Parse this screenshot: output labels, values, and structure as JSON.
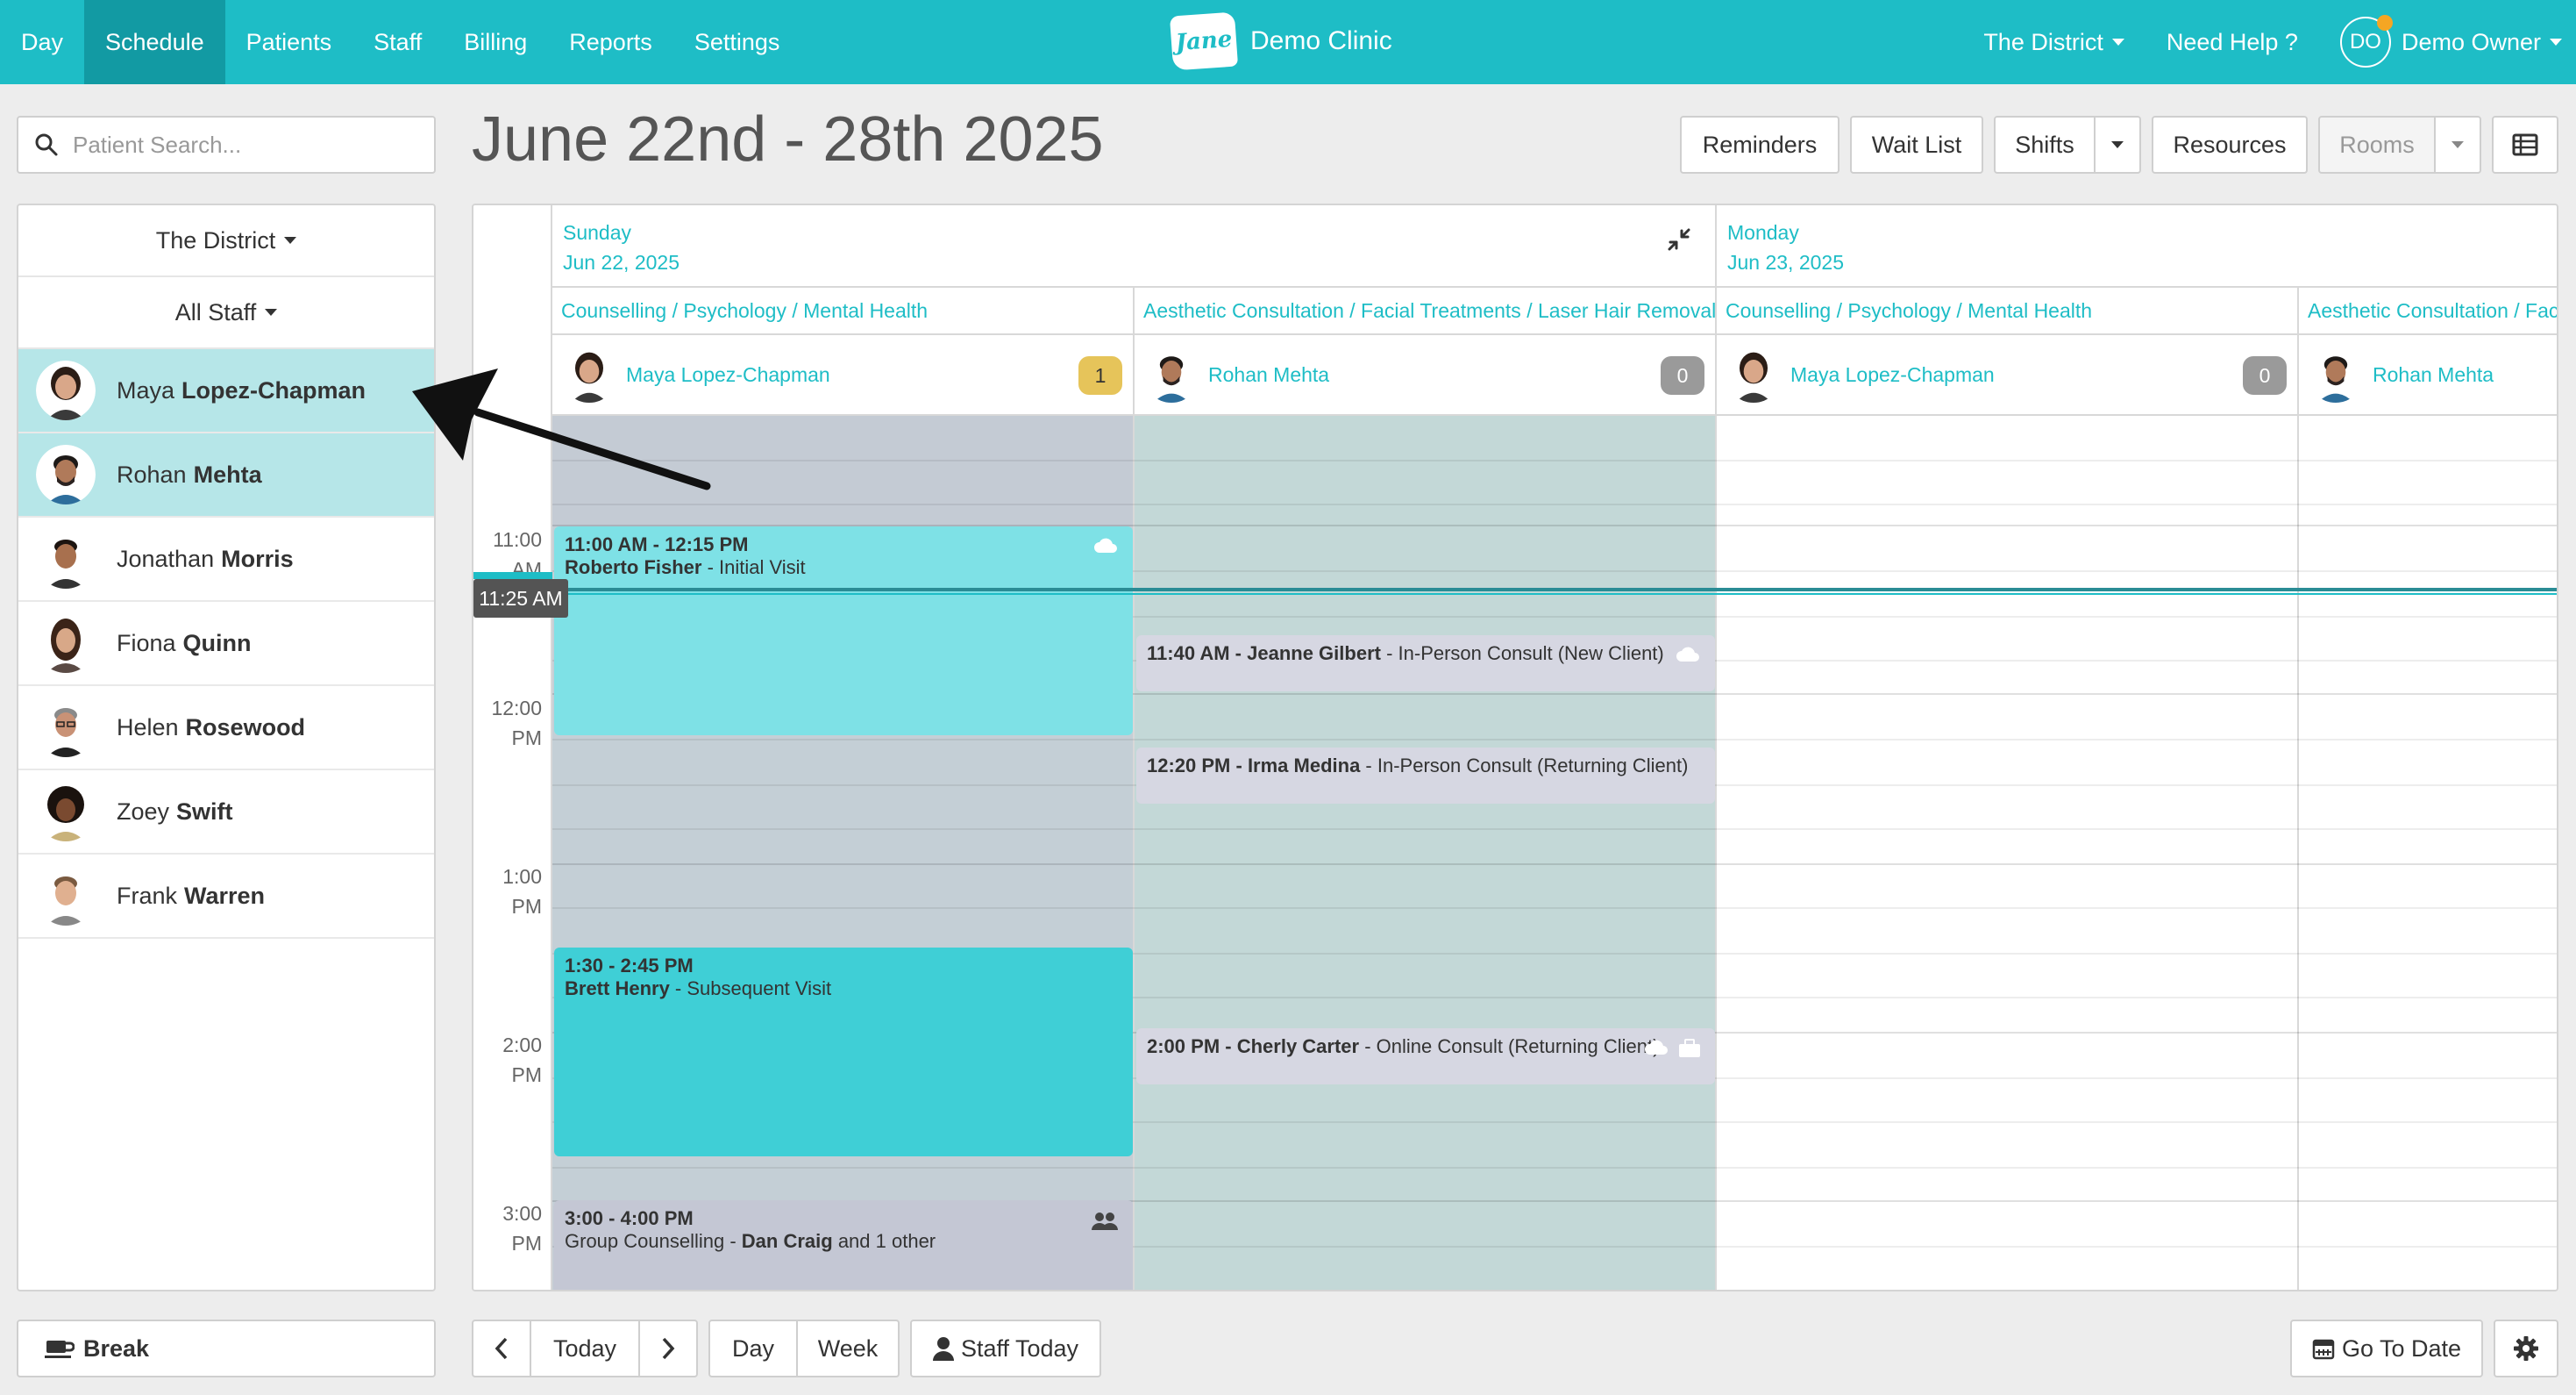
{
  "nav": {
    "items": [
      {
        "label": "Day",
        "active": false
      },
      {
        "label": "Schedule",
        "active": true
      },
      {
        "label": "Patients",
        "active": false
      },
      {
        "label": "Staff",
        "active": false
      },
      {
        "label": "Billing",
        "active": false
      },
      {
        "label": "Reports",
        "active": false
      },
      {
        "label": "Settings",
        "active": false
      }
    ],
    "brand_logo": "Jane",
    "clinic_name": "Demo Clinic",
    "location": "The District",
    "help": "Need Help ?",
    "user_initials": "DO",
    "user_name": "Demo Owner"
  },
  "search": {
    "placeholder": "Patient Search..."
  },
  "filters": {
    "location": "The District",
    "staff": "All Staff"
  },
  "staff": [
    {
      "first": "Maya",
      "last": "Lopez-Chapman",
      "selected": true
    },
    {
      "first": "Rohan",
      "last": "Mehta",
      "selected": true
    },
    {
      "first": "Jonathan",
      "last": "Morris",
      "selected": false
    },
    {
      "first": "Fiona",
      "last": "Quinn",
      "selected": false
    },
    {
      "first": "Helen",
      "last": "Rosewood",
      "selected": false
    },
    {
      "first": "Zoey",
      "last": "Swift",
      "selected": false
    },
    {
      "first": "Frank",
      "last": "Warren",
      "selected": false
    }
  ],
  "header": {
    "date_range": "June 22nd - 28th 2025",
    "reminders": "Reminders",
    "wait_list": "Wait List",
    "shifts": "Shifts",
    "resources": "Resources",
    "rooms": "Rooms"
  },
  "calendar": {
    "days": [
      {
        "weekday": "Sunday",
        "date": "Jun 22, 2025"
      },
      {
        "weekday": "Monday",
        "date": "Jun 23, 2025"
      }
    ],
    "columns": [
      {
        "discipline": "Counselling / Psychology / Mental Health",
        "provider": "Maya Lopez-Chapman",
        "count": "1"
      },
      {
        "discipline": "Aesthetic Consultation / Facial Treatments / Laser Hair Removal",
        "provider": "Rohan Mehta",
        "count": "0"
      },
      {
        "discipline": "Counselling / Psychology / Mental Health",
        "provider": "Maya Lopez-Chapman",
        "count": "0"
      },
      {
        "discipline": "Aesthetic Consultation / Facial Treatments / Laser Hair Removal",
        "provider": "Rohan Mehta",
        "count": ""
      }
    ],
    "times": [
      {
        "hour": "11:00",
        "ampm": "AM"
      },
      {
        "hour": "12:00",
        "ampm": "PM"
      },
      {
        "hour": "1:00",
        "ampm": "PM"
      },
      {
        "hour": "2:00",
        "ampm": "PM"
      },
      {
        "hour": "3:00",
        "ampm": "PM"
      }
    ],
    "now": "11:25 AM",
    "appointments": [
      {
        "time": "11:00 AM - 12:15 PM",
        "patient": "Roberto Fisher",
        "type": " - Initial Visit"
      },
      {
        "time": "1:30 - 2:45 PM",
        "patient": "Brett Henry",
        "type": " - Subsequent Visit"
      },
      {
        "time": "3:00 - 4:00 PM",
        "prefix": "Group Counselling - ",
        "patient": "Dan Craig",
        "suffix": " and 1 other"
      },
      {
        "time": "11:40 AM - ",
        "patient": "Jeanne Gilbert",
        "type": " - In-Person Consult (New Client)"
      },
      {
        "time": "12:20 PM - ",
        "patient": "Irma Medina",
        "type": " - In-Person Consult (Returning Client)"
      },
      {
        "time": "2:00 PM - ",
        "patient": "Cherly Carter",
        "type": " - Online Consult (Returning Client)"
      }
    ]
  },
  "bottom": {
    "break": "Break",
    "today": "Today",
    "day": "Day",
    "week": "Week",
    "staff_today": "Staff Today",
    "go_to_date": "Go To Date"
  },
  "colors": {
    "brand": "#1ebdc6",
    "brand_dark": "#129aa3",
    "badge_gold": "#e6c45a"
  }
}
